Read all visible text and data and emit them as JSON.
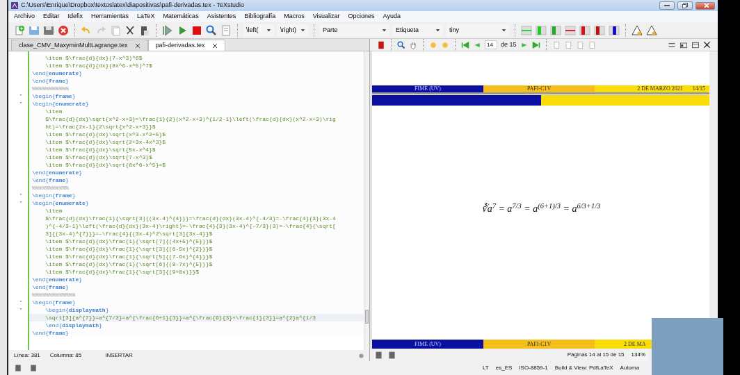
{
  "window": {
    "title": "C:\\Users\\Enrique\\Dropbox\\textoslatex\\diapositivas\\pafi-derivadas.tex - TeXstudio"
  },
  "menu": [
    "Archivo",
    "Editar",
    "Idefix",
    "Herramientas",
    "LaTeX",
    "Matemáticas",
    "Asistentes",
    "Bibliografía",
    "Macros",
    "Visualizar",
    "Opciones",
    "Ayuda"
  ],
  "toolbar": {
    "combos": [
      {
        "value": "\\left("
      },
      {
        "value": "\\right)"
      },
      {
        "value": "Parte"
      },
      {
        "value": "Etiqueta"
      },
      {
        "value": "tiny"
      }
    ]
  },
  "tabs": [
    {
      "label": "clase_CMV_MaxyminMultLagrange.tex",
      "selected": false
    },
    {
      "label": "pafi-derivadas.tex",
      "selected": true
    }
  ],
  "editor": {
    "lines": [
      {
        "kind": "item",
        "text": "    \\item $\\frac{d}{dx}(7-x^3)^6$",
        "fold": false,
        "current": false
      },
      {
        "kind": "item",
        "text": "    \\item $\\frac{d}{dx}(8x^6-x^5)^7$",
        "fold": false,
        "current": false
      },
      {
        "kind": "env",
        "text": "\\end{**enumerate**}",
        "fold": false,
        "current": false
      },
      {
        "kind": "env",
        "text": "\\end{**frame**}",
        "fold": false,
        "current": false
      },
      {
        "kind": "comment",
        "text": "%%%%%%%%%%%",
        "fold": false,
        "current": false
      },
      {
        "kind": "env",
        "text": "\\begin{**frame**}",
        "fold": true,
        "current": false
      },
      {
        "kind": "env",
        "text": "\\begin{**enumerate**}",
        "fold": true,
        "current": false
      },
      {
        "kind": "item",
        "text": "    \\item",
        "fold": false,
        "current": false
      },
      {
        "kind": "item",
        "text": "    $\\frac{d}{dx}\\sqrt{x^2-x+3}=\\frac{1}{2}(x^2-x+3)^{1/2-1}\\left(\\frac{d}{dx}(x^2-x+3)\\rig",
        "fold": false,
        "current": false
      },
      {
        "kind": "item",
        "text": "    ht)=\\frac{2x-1}{2\\sqrt{x^2-x+3}}$",
        "fold": false,
        "current": false
      },
      {
        "kind": "item",
        "text": "    \\item $\\frac{d}{dx}\\sqrt{x^3-x^2+5}$",
        "fold": false,
        "current": false
      },
      {
        "kind": "item",
        "text": "    \\item $\\frac{d}{dx}\\sqrt{2+3x-4x^3}$",
        "fold": false,
        "current": false
      },
      {
        "kind": "item",
        "text": "    \\item $\\frac{d}{dx}\\sqrt{5x-x^4}$",
        "fold": false,
        "current": false
      },
      {
        "kind": "item",
        "text": "    \\item $\\frac{d}{dx}\\sqrt{7-x^3}$",
        "fold": false,
        "current": false
      },
      {
        "kind": "item",
        "text": "    \\item $\\frac{d}{dx}\\sqrt{8x^6-x^5}=$",
        "fold": false,
        "current": false
      },
      {
        "kind": "env",
        "text": "\\end{**enumerate**}",
        "fold": false,
        "current": false
      },
      {
        "kind": "env",
        "text": "\\end{**frame**}",
        "fold": false,
        "current": false
      },
      {
        "kind": "comment",
        "text": "%%%%%%%%%%%",
        "fold": false,
        "current": false
      },
      {
        "kind": "env",
        "text": "\\begin{**frame**}",
        "fold": true,
        "current": false
      },
      {
        "kind": "env",
        "text": "\\begin{**enumerate**}",
        "fold": true,
        "current": false
      },
      {
        "kind": "item",
        "text": "    \\item",
        "fold": false,
        "current": false
      },
      {
        "kind": "item",
        "text": "    $\\frac{d}{dx}\\frac{1}{\\sqrt[3]{(3x-4)^{4}}}=\\frac{d}{dx}(3x-4)^{-4/3}=-\\frac{4}{3}(3x-4",
        "fold": false,
        "current": false
      },
      {
        "kind": "item",
        "text": "    )^{-4/3-1}\\left(\\frac{d}{dx}(3x-4)\\right)=-\\frac{4}{3}(3x-4)^{-7/3}(3)=-\\frac{4}{\\sqrt[",
        "fold": false,
        "current": false
      },
      {
        "kind": "item",
        "text": "    3]{(3x-4)^{7}}}=-\\frac{4}{(3x-4)^2\\sqrt[3]{3x-4}}$",
        "fold": false,
        "current": false
      },
      {
        "kind": "item",
        "text": "    \\item $\\frac{d}{dx}\\frac{1}{\\sqrt[7]{(4x+5)^{5}}}$",
        "fold": false,
        "current": false
      },
      {
        "kind": "item",
        "text": "    \\item $\\frac{d}{dx}\\frac{1}{\\sqrt[3]{(6-5x)^{2}}}$",
        "fold": false,
        "current": false
      },
      {
        "kind": "item",
        "text": "    \\item $\\frac{d}{dx}\\frac{1}{\\sqrt[5]{(7-6x)^{4}}}$",
        "fold": false,
        "current": false
      },
      {
        "kind": "item",
        "text": "    \\item $\\frac{d}{dx}\\frac{1}{\\sqrt[6]{(8-7x)^{5}}}$",
        "fold": false,
        "current": false
      },
      {
        "kind": "item",
        "text": "    \\item $\\frac{d}{dx}\\frac{1}{\\sqrt[3]{(9+8x)}}$",
        "fold": false,
        "current": false
      },
      {
        "kind": "env",
        "text": "\\end{**enumerate**}",
        "fold": false,
        "current": false
      },
      {
        "kind": "env",
        "text": "\\end{**frame**}",
        "fold": false,
        "current": false
      },
      {
        "kind": "comment",
        "text": "%%%%%%%%%%%%%",
        "fold": false,
        "current": false
      },
      {
        "kind": "env",
        "text": "\\begin{**frame**}",
        "fold": true,
        "current": false
      },
      {
        "kind": "env",
        "text": "    \\begin{**displaymath**}",
        "fold": true,
        "current": false
      },
      {
        "kind": "item",
        "text": "    \\sqrt[3]{a^{7}}=a^{7/3}=a^{\\frac{6+1}{3}}=a^{\\frac{6}{3}+\\frac{1}{3}}=a^{2}a^{1/3",
        "fold": false,
        "current": true
      },
      {
        "kind": "env",
        "text": "    \\end{**displaymath**}",
        "fold": false,
        "current": false
      },
      {
        "kind": "env",
        "text": "\\end{**frame**}",
        "fold": false,
        "current": false
      }
    ]
  },
  "editor_status": {
    "line": "Línea: 381",
    "column": "Columna: 85",
    "mode": "INSERTAR"
  },
  "viewer": {
    "page_field": "14",
    "page_total": "de 15",
    "header": {
      "left": "FIME (UV)",
      "center": "PAFI-C1V",
      "date": "2 DE MARZO 2021",
      "page": "14/15"
    },
    "progress": {
      "level": 0.5
    },
    "formula": "∛a$^{7}$ = a$^{7/3}$ = a$^{(6+1)/3}$ = a$^{6/3+1/3}$",
    "footer": {
      "left": "FIME (UV)",
      "center": "PAFI-C1V",
      "date": "2 DE MA"
    },
    "status": {
      "pages": "Páginas 14 al 15 de 15",
      "zoom": "134%"
    }
  },
  "status_bar": [
    "LT",
    "es_ES",
    "ISO-8859-1",
    "Build & View: PdfLaTeX",
    "Automa"
  ]
}
